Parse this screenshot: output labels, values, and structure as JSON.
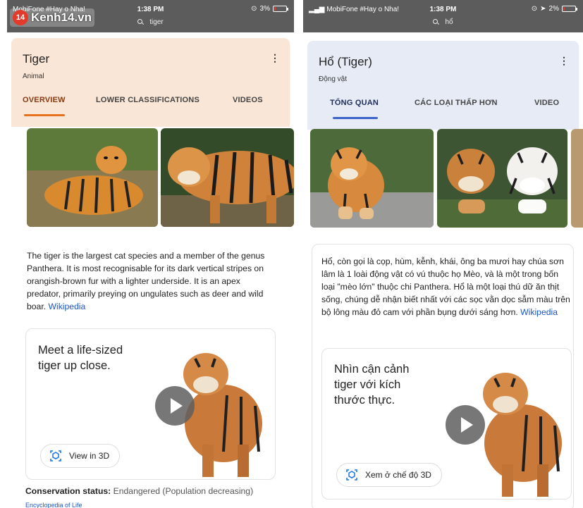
{
  "watermark": {
    "logo": "14",
    "text": "Kenh14.vn"
  },
  "left": {
    "status": {
      "carrier": "MobiFone #Hay o Nha!",
      "time": "1:38 PM",
      "battery": "3%",
      "search_query": "tiger"
    },
    "title": "Tiger",
    "subtitle": "Animal",
    "tabs": [
      "OVERVIEW",
      "LOWER CLASSIFICATIONS",
      "VIDEOS"
    ],
    "description": "The tiger is the largest cat species and a member of the genus Panthera. It is most recognisable for its dark vertical stripes on orangish-brown fur with a lighter underside. It is an apex predator, primarily preying on ungulates such as deer and wild boar.",
    "description_link": "Wikipedia",
    "card_title": "Meet a life-sized\ntiger up close.",
    "view3d_label": "View in 3D",
    "conservation_label": "Conservation status:",
    "conservation_value": "Endangered (Population decreasing)",
    "source": "Encyclopedia of Life",
    "accent": "#e8711d"
  },
  "right": {
    "status": {
      "carrier": "MobiFone #Hay o Nha!",
      "time": "1:38 PM",
      "battery": "2%",
      "search_query": "hổ"
    },
    "title": "Hổ (Tiger)",
    "subtitle": "Động vật",
    "tabs": [
      "TỔNG QUAN",
      "CÁC LOẠI THẤP HƠN",
      "VIDEO"
    ],
    "description": "Hổ, còn gọi là cọp, hùm, kễnh, khái, ông ba mươi hay chúa sơn lâm là 1 loài động vật có vú thuộc họ Mèo, và là một trong bốn loại \"mèo lớn\" thuộc chi Panthera. Hổ là một loại thú dữ ăn thịt sống, chúng dễ nhận biết nhất với các sọc vằn dọc sẫm màu trên bộ lông màu đỏ cam với phần bụng dưới sáng hơn.",
    "description_link": "Wikipedia",
    "card_title": "Nhìn cận cảnh\ntiger với kích\nthước thực.",
    "view3d_label": "Xem ở chế độ 3D",
    "accent": "#3c63c9"
  }
}
